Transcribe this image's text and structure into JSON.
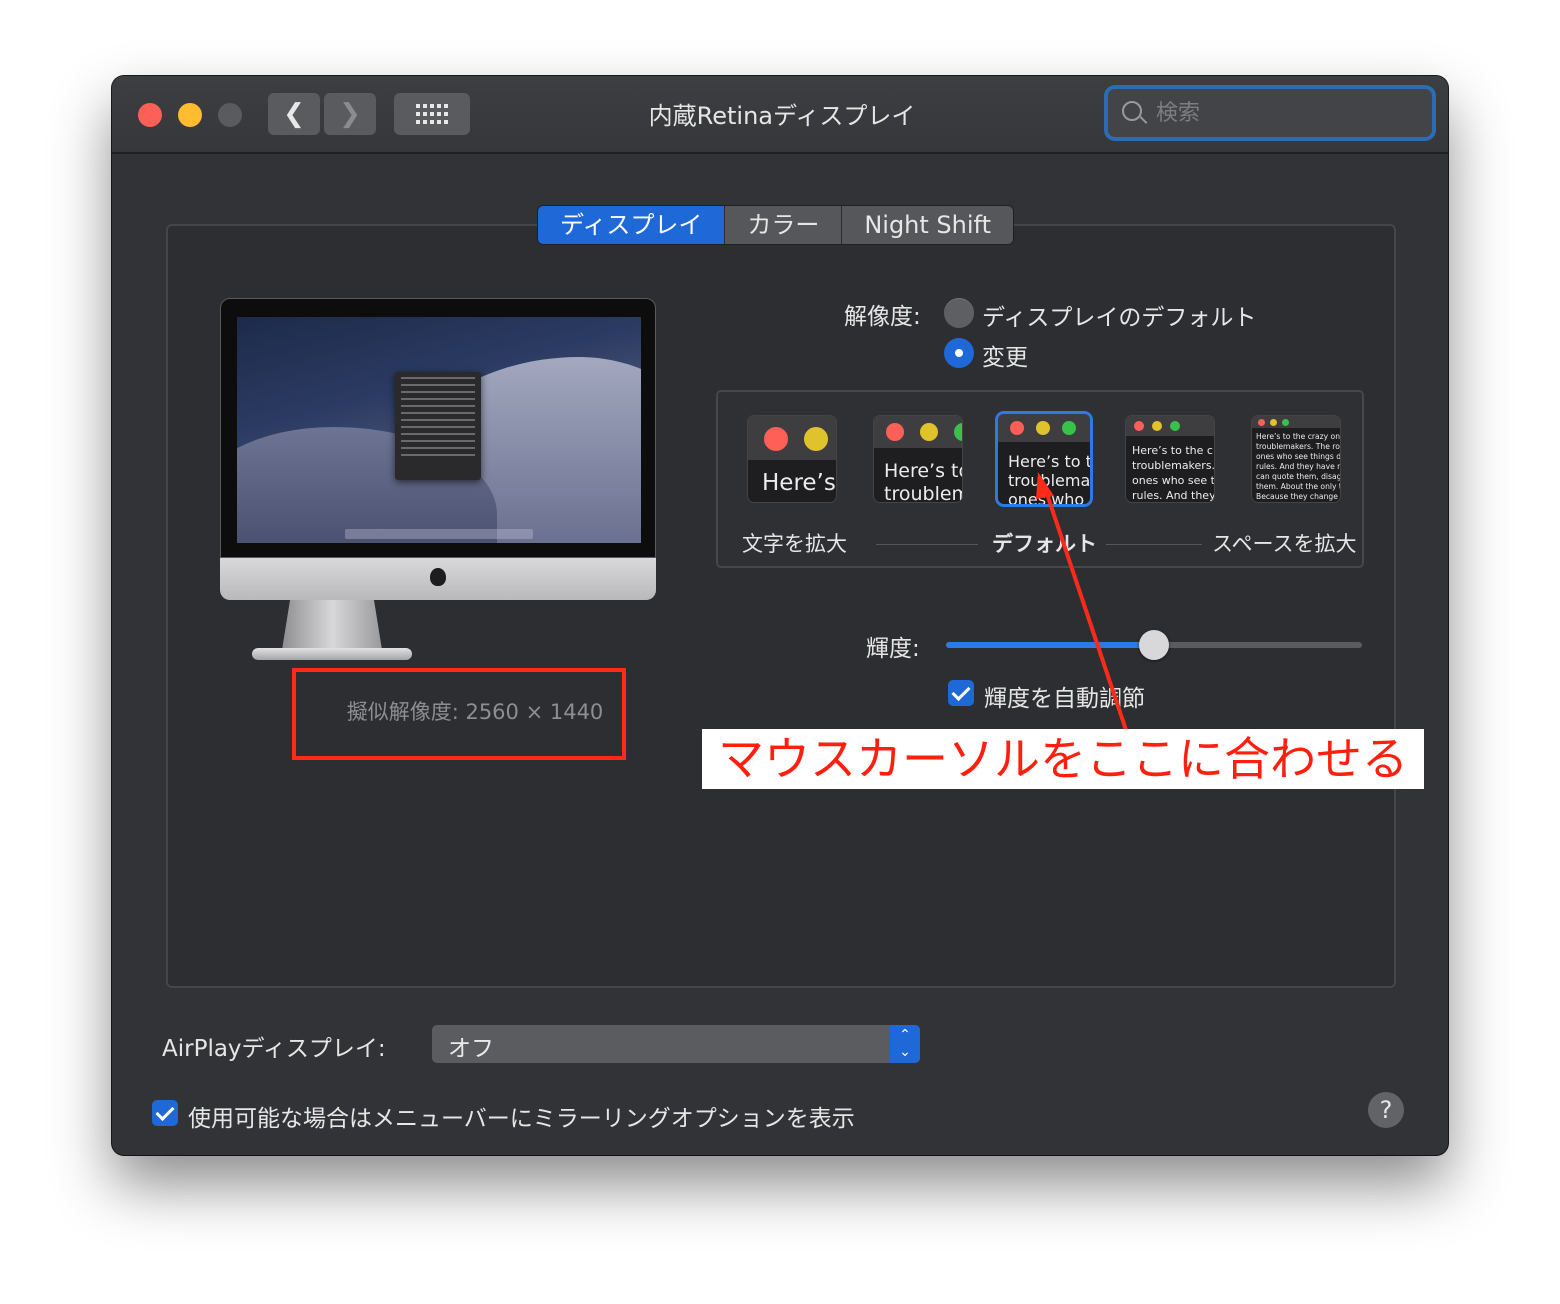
{
  "window": {
    "title": "内蔵Retinaディスプレイ",
    "search_placeholder": "検索"
  },
  "tabs": [
    {
      "label": "ディスプレイ",
      "active": true
    },
    {
      "label": "カラー",
      "active": false
    },
    {
      "label": "Night Shift",
      "active": false
    }
  ],
  "display": {
    "simulated_resolution": "擬似解像度: 2560 × 1440"
  },
  "resolution": {
    "label": "解像度:",
    "option_default": "ディスプレイのデフォルト",
    "option_scaled": "変更",
    "selected": "変更"
  },
  "scaling": {
    "thumbnails": [
      {
        "text": "Here’s"
      },
      {
        "text": "Here’s to\ntroublem"
      },
      {
        "text": "Here’s to t\ntroublema\nones who",
        "selected": true
      },
      {
        "text": "Here’s to the cr\ntroublemakers.\nones who see t\nrules. And they"
      },
      {
        "text": "Here’s to the crazy one\ntroublemakers. The rou\nones who see things dif\nrules. And they have no\ncan quote them, disagr\nthem. About the only th\nBecause they change th"
      }
    ],
    "label_left": "文字を拡大",
    "label_center": "デフォルト",
    "label_right": "スペースを拡大"
  },
  "brightness": {
    "label": "輝度:",
    "value": 0.5,
    "auto_label": "輝度を自動調節",
    "auto_checked": true
  },
  "annotation": {
    "text": "マウスカーソルをここに合わせる",
    "color": "#ff1f0e"
  },
  "airplay": {
    "label": "AirPlayディスプレイ:",
    "value": "オフ"
  },
  "mirroring": {
    "label": "使用可能な場合はメニューバーにミラーリングオプションを表示",
    "checked": true
  },
  "help": {
    "label": "?"
  },
  "colors": {
    "accent": "#1f68d8",
    "close": "#fe5f57",
    "minimize": "#febc2e",
    "annotation_red": "#ff2a1a"
  }
}
